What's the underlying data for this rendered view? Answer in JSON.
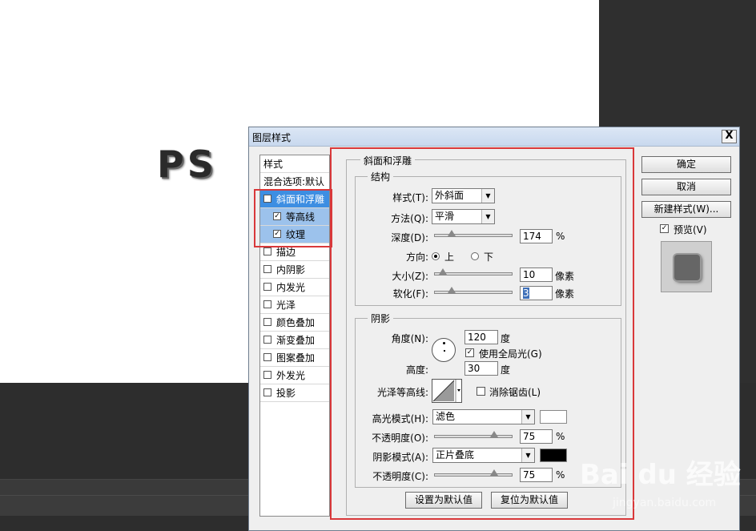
{
  "canvas": {
    "doc_text": "PS"
  },
  "dialog": {
    "title": "图层样式",
    "close": "X",
    "style_list": [
      {
        "label": "样式",
        "checkbox": false,
        "checked": false,
        "state": "header"
      },
      {
        "label": "混合选项:默认",
        "checkbox": false,
        "checked": false,
        "state": "normal"
      },
      {
        "label": "斜面和浮雕",
        "checkbox": true,
        "checked": true,
        "state": "selected"
      },
      {
        "label": "等高线",
        "checkbox": true,
        "checked": true,
        "state": "sub"
      },
      {
        "label": "纹理",
        "checkbox": true,
        "checked": true,
        "state": "sub"
      },
      {
        "label": "描边",
        "checkbox": true,
        "checked": false,
        "state": "normal"
      },
      {
        "label": "内阴影",
        "checkbox": true,
        "checked": false,
        "state": "normal"
      },
      {
        "label": "内发光",
        "checkbox": true,
        "checked": false,
        "state": "normal"
      },
      {
        "label": "光泽",
        "checkbox": true,
        "checked": false,
        "state": "normal"
      },
      {
        "label": "颜色叠加",
        "checkbox": true,
        "checked": false,
        "state": "normal"
      },
      {
        "label": "渐变叠加",
        "checkbox": true,
        "checked": false,
        "state": "normal"
      },
      {
        "label": "图案叠加",
        "checkbox": true,
        "checked": false,
        "state": "normal"
      },
      {
        "label": "外发光",
        "checkbox": true,
        "checked": false,
        "state": "normal"
      },
      {
        "label": "投影",
        "checkbox": true,
        "checked": false,
        "state": "normal"
      }
    ],
    "panel": {
      "title": "斜面和浮雕",
      "structure": {
        "title": "结构",
        "style_label": "样式(T):",
        "style_value": "外斜面",
        "technique_label": "方法(Q):",
        "technique_value": "平滑",
        "depth_label": "深度(D):",
        "depth_value": "174",
        "depth_unit": "%",
        "depth_fraction": 0.17,
        "direction_label": "方向:",
        "direction_up": "上",
        "direction_down": "下",
        "size_label": "大小(Z):",
        "size_value": "10",
        "size_unit": "像素",
        "size_fraction": 0.05,
        "soften_label": "软化(F):",
        "soften_value": "3",
        "soften_unit": "像素",
        "soften_fraction": 0.17
      },
      "shading": {
        "title": "阴影",
        "angle_label": "角度(N):",
        "angle_value": "120",
        "angle_unit": "度",
        "global_light_label": "使用全局光(G)",
        "altitude_label": "高度:",
        "altitude_value": "30",
        "altitude_unit": "度",
        "gloss_label": "光泽等高线:",
        "antialias_label": "消除锯齿(L)",
        "highlight_mode_label": "高光模式(H):",
        "highlight_mode_value": "滤色",
        "highlight_color": "#ffffff",
        "highlight_opacity_label": "不透明度(O):",
        "highlight_opacity_value": "75",
        "highlight_opacity_unit": "%",
        "highlight_opacity_fraction": 0.75,
        "shadow_mode_label": "阴影模式(A):",
        "shadow_mode_value": "正片叠底",
        "shadow_color": "#000000",
        "shadow_opacity_label": "不透明度(C):",
        "shadow_opacity_value": "75",
        "shadow_opacity_unit": "%",
        "shadow_opacity_fraction": 0.75
      },
      "make_default": "设置为默认值",
      "reset_default": "复位为默认值"
    },
    "buttons": {
      "ok": "确定",
      "cancel": "取消",
      "new_style": "新建样式(W)...",
      "preview_label": "预览(V)"
    }
  },
  "watermark": {
    "main": "Bai du 经验",
    "sub": "jingyan.baidu.com"
  },
  "colors": {
    "selection": "#3d8ee2",
    "highlight_red": "#d9383a"
  }
}
